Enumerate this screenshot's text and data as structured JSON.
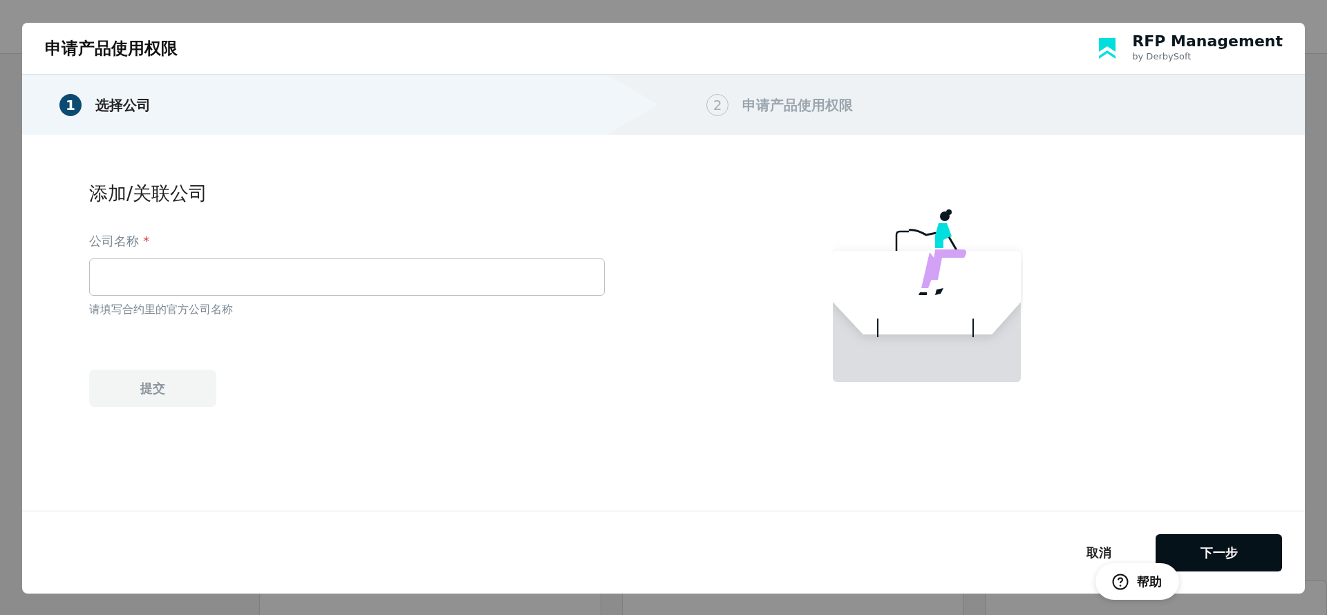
{
  "dialog": {
    "title": "申请产品使用权限"
  },
  "brand": {
    "name": "RFP Management",
    "byline": "by DerbySoft"
  },
  "steps": [
    {
      "number": "1",
      "label": "选择公司",
      "selected": true
    },
    {
      "number": "2",
      "label": "申请产品使用权限",
      "selected": false
    }
  ],
  "form": {
    "heading": "添加/关联公司",
    "field_label": "公司名称",
    "required": true,
    "required_mark": "*",
    "hint": "请填写合约里的官方公司名称",
    "submit": {
      "label": "提交",
      "disabled": true
    }
  },
  "footer": {
    "cancel": "取消",
    "next": "下一步"
  },
  "help": {
    "label": "帮助"
  }
}
